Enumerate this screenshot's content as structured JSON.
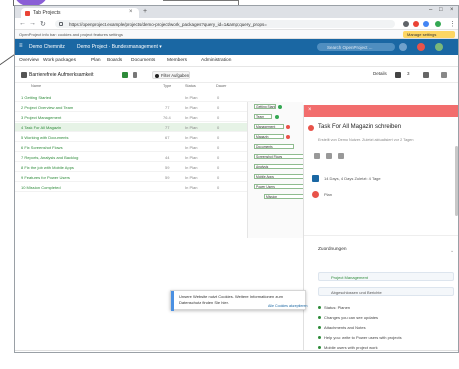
{
  "browser": {
    "tab_title": "Tab Projects",
    "tab_close": "×",
    "new_tab": "+",
    "win_min": "–",
    "win_max": "□",
    "win_close": "×",
    "url": "https://openproject.example/projects/demo-project/work_packages?query_id=1&amp;query_props=",
    "info_text": "OpenProject info bar: cookies and project features settings",
    "info_button": "Manage settings"
  },
  "header": {
    "menu": "≡",
    "app_name": "Demo Chemnitz",
    "project_name": "Demo Project · Bundesmanagement ▾",
    "search_placeholder": "Search OpenProject ...",
    "accent": "#1a67a3"
  },
  "subnav": {
    "items": [
      "Overview",
      "Work packages",
      "Plan",
      "Boards",
      "Documents",
      "Members",
      "Administration"
    ]
  },
  "toolbar": {
    "title": "Barrierefreie Aufmerksamkeit",
    "create_button": "Create",
    "status_filter": "Filter Aufgaben",
    "right_label": "Details",
    "right_count": "3"
  },
  "table": {
    "headers": [
      "Name",
      "Type",
      "Status",
      "Dauer"
    ],
    "rows": [
      {
        "name": "1 Getting Started",
        "type": "",
        "status": "In Plan",
        "dur": "0"
      },
      {
        "name": "2 Project Overview and Team",
        "type": "77",
        "status": "In Plan",
        "dur": "0"
      },
      {
        "name": "3 Project Management",
        "type": "76.4",
        "status": "In Plan",
        "dur": "0"
      },
      {
        "name": "4 Task For All Magazin",
        "type": "77",
        "status": "In Plan",
        "dur": "0"
      },
      {
        "name": "5 Working with Documents",
        "type": "67",
        "status": "In Plan",
        "dur": "0"
      },
      {
        "name": "6 Fix Screenshot Flows",
        "type": "",
        "status": "In Plan",
        "dur": "0"
      },
      {
        "name": "7 Reports, Analysis and Backlog",
        "type": "44",
        "status": "In Plan",
        "dur": "0"
      },
      {
        "name": "8 Fix the job with Mobile Apps",
        "type": "59",
        "status": "In Plan",
        "dur": "0"
      },
      {
        "name": "9 Features for Power Users",
        "type": "59",
        "status": "In Plan",
        "dur": "0"
      },
      {
        "name": "10 Mission Completed",
        "type": "",
        "status": "In Plan",
        "dur": "0"
      }
    ]
  },
  "gantt": {
    "bars": [
      "Getting Started",
      "Team",
      "Management",
      "Magazin",
      "Documents",
      "Screenshot Flows",
      "Analysis",
      "Mobile Apps",
      "Power Users",
      "Mission"
    ]
  },
  "panel": {
    "close": "×",
    "title": "Task For All Magazin schreiben",
    "subtitle": "Erstellt von Demo Nutzer. Zuletzt aktualisiert vor 2 Tagen",
    "meta_date": "14 Days, 4 Days  Zuletzt: 4 Tage",
    "meta_user": "Plan",
    "section": "Zuordnungen",
    "field_project": "Project Management",
    "field_text": "Abgeschlossen und Berichte",
    "checklist": [
      "Status: Planen",
      "Changes you can see updates",
      "Attachments and Notes",
      "Help you: write to Power users with projects",
      "Mobile users with project work"
    ]
  },
  "toast": {
    "message": "Unsere Website nutzt Cookies. Weitere Informationen zum Datenschutz finden Sie hier.",
    "link": "Alle Cookies akzeptieren"
  }
}
